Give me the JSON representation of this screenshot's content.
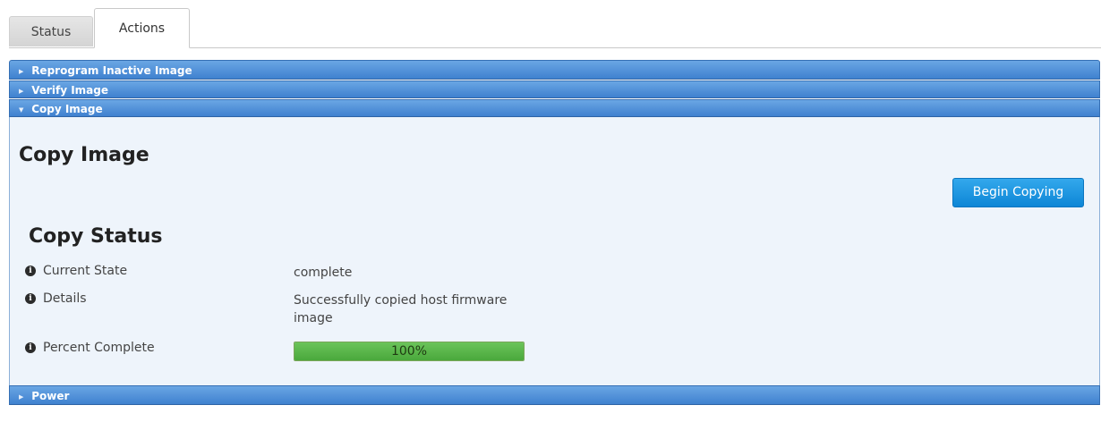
{
  "tabs": [
    {
      "label": "Status"
    },
    {
      "label": "Actions"
    }
  ],
  "accordion": {
    "sections": [
      {
        "label": "Reprogram Inactive Image"
      },
      {
        "label": "Verify Image"
      },
      {
        "label": "Copy Image"
      },
      {
        "label": "Power"
      }
    ]
  },
  "copy_panel": {
    "title": "Copy Image",
    "button_label": "Begin Copying",
    "status_title": "Copy Status",
    "rows": [
      {
        "label": "Current State",
        "value": "complete"
      },
      {
        "label": "Details",
        "value": "Successfully copied host firmware image"
      },
      {
        "label": "Percent Complete",
        "value": "100%"
      }
    ],
    "progress_fraction": 1.0
  },
  "icons": {
    "info": "info-circle-icon",
    "collapsed": "triangle-right-icon",
    "expanded": "triangle-down-icon"
  },
  "colors": {
    "header_blue": "#3f81cf",
    "button_blue": "#0d86d6",
    "progress_green": "#4aa83c",
    "panel_bg": "#eef4fb"
  }
}
